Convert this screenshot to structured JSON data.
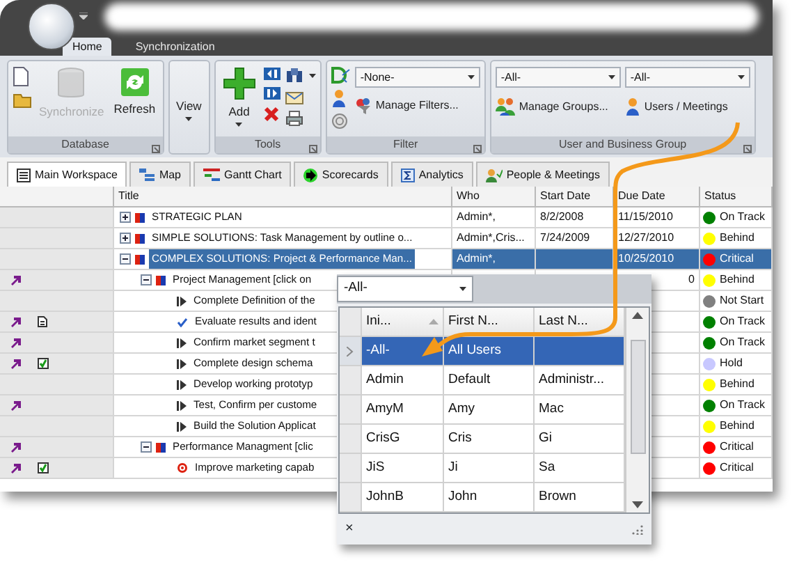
{
  "ribbon": {
    "tabs": [
      {
        "label": "Home",
        "selected": true
      },
      {
        "label": "Synchronization",
        "selected": false
      }
    ],
    "groups": [
      {
        "title": "Database",
        "controls": [
          {
            "kind": "icon-stack"
          },
          {
            "kind": "large",
            "label": "Synchronize",
            "disabled": true,
            "dropdown": false
          },
          {
            "kind": "large",
            "label": "Refresh",
            "disabled": false,
            "dropdown": false
          }
        ]
      },
      {
        "controls": [
          {
            "kind": "large",
            "label": "View",
            "disabled": false,
            "dropdown": true
          }
        ]
      },
      {
        "title": "Tools",
        "controls": [
          {
            "kind": "large",
            "label": "Add",
            "disabled": false,
            "dropdown": true
          },
          {
            "kind": "icon-stack"
          },
          {
            "kind": "icon-stack"
          }
        ]
      },
      {
        "title": "Filter",
        "controls": [
          {
            "kind": "icon-stack"
          },
          {
            "kind": "select-stack",
            "value": "-None-",
            "label": "Manage Filters..."
          }
        ]
      },
      {
        "title": "User and Business Group",
        "controls": [
          {
            "kind": "select-stack",
            "value": "-All-",
            "label": "Manage Groups..."
          },
          {
            "kind": "select-stack",
            "value": "-All-",
            "label": "Users / Meetings"
          }
        ]
      }
    ]
  },
  "workspace_tabs": [
    {
      "label": "Main Workspace",
      "selected": true
    },
    {
      "label": "Map",
      "selected": false
    },
    {
      "label": "Gantt Chart",
      "selected": false
    },
    {
      "label": "Scorecards",
      "selected": false
    },
    {
      "label": "Analytics",
      "selected": false
    },
    {
      "label": "People & Meetings",
      "selected": false
    }
  ],
  "grid": {
    "columns": [
      "Title",
      "Who",
      "Start Date",
      "Due Date",
      "Status"
    ],
    "rows": [
      {
        "title": "STRATEGIC PLAN",
        "kind": "plan",
        "expanded": false,
        "selected": false,
        "link_mark": false,
        "doc_mark": false,
        "check_mark": false,
        "who": "Admin*,",
        "start_date": "8/2/2008",
        "due_date": "11/15/2010",
        "status": "On Track",
        "color": "#008000"
      },
      {
        "title": "SIMPLE SOLUTIONS: Task Management by outline o...",
        "kind": "plan",
        "expanded": false,
        "selected": false,
        "link_mark": false,
        "doc_mark": false,
        "check_mark": false,
        "who": "Admin*,Cris...",
        "start_date": "7/24/2009",
        "due_date": "12/27/2010",
        "status": "Behind",
        "color": "#ffff00"
      },
      {
        "title": "COMPLEX SOLUTIONS: Project & Performance Man...",
        "kind": "plan",
        "expanded": true,
        "selected": true,
        "link_mark": false,
        "doc_mark": false,
        "check_mark": false,
        "who": "Admin*,",
        "due_date": "10/25/2010",
        "status": "Critical",
        "color": "#ff0000",
        "children": [
          {
            "title": "Project Management [click on",
            "kind": "plan",
            "expanded": true,
            "selected": false,
            "link_mark": true,
            "doc_mark": false,
            "check_mark": false,
            "due_date": "0",
            "status": "Behind",
            "color": "#ffff00",
            "children": [
              {
                "title": "Complete Definition of the",
                "kind": "task",
                "selected": false,
                "link_mark": false,
                "doc_mark": false,
                "check_mark": false,
                "status": "Not Start",
                "color": "#808080"
              },
              {
                "title": "Evaluate results and ident",
                "kind": "done",
                "selected": false,
                "link_mark": true,
                "doc_mark": true,
                "check_mark": false,
                "status": "On Track",
                "color": "#008000"
              },
              {
                "title": "Confirm market segment t",
                "kind": "task",
                "selected": false,
                "link_mark": true,
                "doc_mark": false,
                "check_mark": false,
                "status": "On Track",
                "color": "#008000"
              },
              {
                "title": "Complete design schema",
                "kind": "task",
                "selected": false,
                "link_mark": true,
                "doc_mark": false,
                "check_mark": true,
                "status": "Hold",
                "color": "#c8c8ff"
              },
              {
                "title": "Develop working prototyp",
                "kind": "task",
                "selected": false,
                "link_mark": false,
                "doc_mark": false,
                "check_mark": false,
                "status": "Behind",
                "color": "#ffff00"
              },
              {
                "title": "Test, Confirm per custome",
                "kind": "task",
                "selected": false,
                "link_mark": true,
                "doc_mark": false,
                "check_mark": false,
                "status": "On Track",
                "color": "#008000"
              },
              {
                "title": "Build the Solution Applicat",
                "kind": "task",
                "selected": false,
                "link_mark": false,
                "doc_mark": false,
                "check_mark": false,
                "status": "Behind",
                "color": "#ffff00"
              }
            ]
          },
          {
            "title": "Performance Managment [clic",
            "kind": "plan",
            "expanded": true,
            "selected": false,
            "link_mark": true,
            "doc_mark": false,
            "check_mark": false,
            "status": "Critical",
            "color": "#ff0000",
            "children": [
              {
                "title": "Improve marketing capab",
                "kind": "goal",
                "selected": false,
                "link_mark": true,
                "doc_mark": false,
                "check_mark": true,
                "status": "Critical",
                "color": "#ff0000"
              }
            ]
          }
        ]
      }
    ]
  },
  "user_picker": {
    "value": "-All-",
    "columns": [
      {
        "label": "Ini...",
        "sorted": true
      },
      {
        "label": "First N...",
        "sorted": false
      },
      {
        "label": "Last N...",
        "sorted": false
      }
    ],
    "rows": [
      {
        "initials": "-All-",
        "first": "All Users",
        "selected": true
      },
      {
        "initials": "Admin",
        "first": "Default",
        "last": "Administr...",
        "selected": false
      },
      {
        "initials": "AmyM",
        "first": "Amy",
        "last": "Mac",
        "selected": false
      },
      {
        "initials": "CrisG",
        "first": "Cris",
        "last": "Gi",
        "selected": false
      },
      {
        "initials": "JiS",
        "first": "Ji",
        "last": "Sa",
        "selected": false
      },
      {
        "initials": "JohnB",
        "first": "John",
        "last": "Brown",
        "selected": false
      }
    ],
    "close": "×"
  }
}
